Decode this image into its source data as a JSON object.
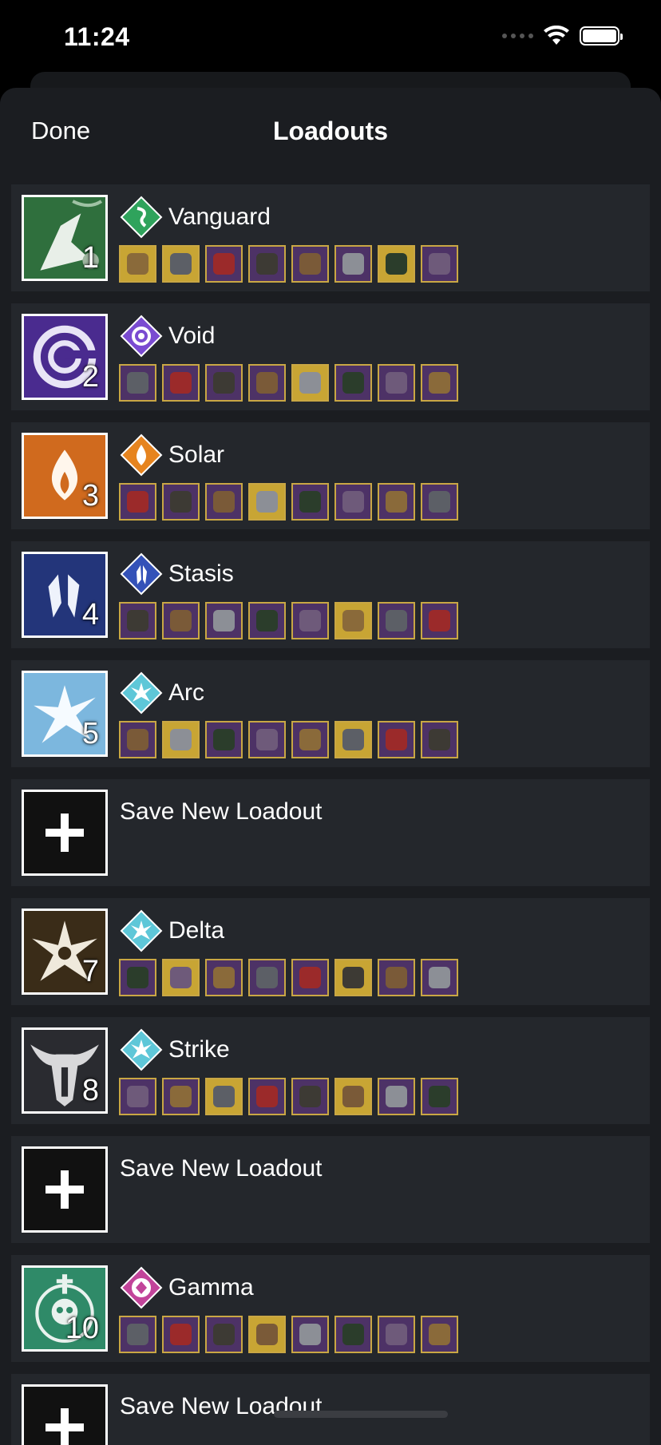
{
  "status": {
    "time": "11:24"
  },
  "nav": {
    "done": "Done",
    "title": "Loadouts"
  },
  "loadouts": [
    {
      "type": "loadout",
      "name": "Vanguard",
      "number": "1",
      "emblem": "dragon-scale-emblem",
      "subclass": "strand",
      "items": [
        "gold",
        "gold",
        "purple",
        "purple",
        "purple",
        "purple",
        "gold",
        "purple"
      ]
    },
    {
      "type": "loadout",
      "name": "Void",
      "number": "2",
      "emblem": "void-emblem",
      "subclass": "void",
      "items": [
        "purple",
        "purple",
        "purple",
        "purple",
        "gold",
        "purple",
        "purple",
        "purple"
      ]
    },
    {
      "type": "loadout",
      "name": "Solar",
      "number": "3",
      "emblem": "solar-emblem",
      "subclass": "solar",
      "items": [
        "purple",
        "purple",
        "purple",
        "gold",
        "purple",
        "purple",
        "purple",
        "purple"
      ]
    },
    {
      "type": "loadout",
      "name": "Stasis",
      "number": "4",
      "emblem": "stasis-emblem",
      "subclass": "stasis",
      "items": [
        "purple",
        "purple",
        "purple",
        "purple",
        "purple",
        "gold",
        "purple",
        "purple"
      ]
    },
    {
      "type": "loadout",
      "name": "Arc",
      "number": "5",
      "emblem": "arc-emblem",
      "subclass": "arc",
      "items": [
        "purple",
        "gold",
        "purple",
        "purple",
        "purple",
        "gold",
        "purple",
        "purple"
      ]
    },
    {
      "type": "new",
      "label": "Save New Loadout"
    },
    {
      "type": "loadout",
      "name": "Delta",
      "number": "7",
      "emblem": "delta-emblem",
      "subclass": "arc",
      "items": [
        "purple",
        "gold",
        "purple",
        "purple",
        "purple",
        "gold",
        "purple",
        "purple"
      ]
    },
    {
      "type": "loadout",
      "name": "Strike",
      "number": "8",
      "emblem": "bull-skull-emblem",
      "subclass": "arc",
      "items": [
        "purple",
        "purple",
        "gold",
        "purple",
        "purple",
        "gold",
        "purple",
        "purple"
      ]
    },
    {
      "type": "new",
      "label": "Save New Loadout"
    },
    {
      "type": "loadout",
      "name": "Gamma",
      "number": "10",
      "emblem": "skull-emblem",
      "subclass": "prismatic",
      "items": [
        "purple",
        "purple",
        "purple",
        "gold",
        "purple",
        "purple",
        "purple",
        "purple"
      ]
    },
    {
      "type": "new",
      "label": "Save New Loadout"
    }
  ],
  "colors": {
    "sheet": "#1b1d21",
    "row": "#24272c",
    "exotic": "#c8a534",
    "legendary": "#4d3266",
    "item_border": "#c9a744"
  }
}
